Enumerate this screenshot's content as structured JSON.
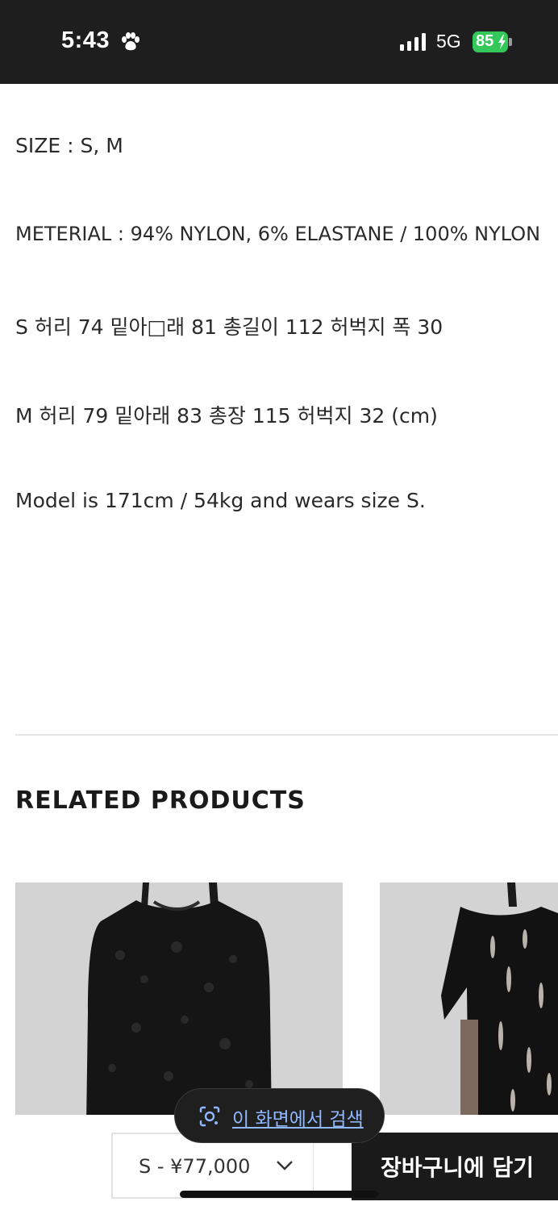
{
  "status_bar": {
    "time": "5:43",
    "network": "5G",
    "battery": "85",
    "icons": [
      "paw-icon",
      "signal-icon",
      "battery-icon",
      "bolt-icon"
    ],
    "accent_color": "#34c759"
  },
  "product_details": {
    "lines": [
      "SIZE : S, M",
      "METERIAL : 94% NYLON, 6% ELASTANE / 100% NYLON",
      "S 허리 74 밑아□래 81 총길이 112 허벅지 폭 30",
      "M 허리 79 밑아래 83 총장 115 허벅지 32 (cm)",
      "Model is 171cm / 54kg and wears size S."
    ]
  },
  "related": {
    "title": "RELATED PRODUCTS",
    "products": [
      {
        "name": "black lace long sleeve top",
        "image_bg": "#d2d3d2"
      },
      {
        "name": "black slashed t-shirt",
        "image_bg": "#d2d3d2"
      }
    ]
  },
  "purchase_bar": {
    "option_label": "S - ¥77,000",
    "add_to_cart": "장바구니에 담기"
  },
  "overlay": {
    "search_label": "이 화면에서 검색",
    "icon": "lens-icon"
  }
}
